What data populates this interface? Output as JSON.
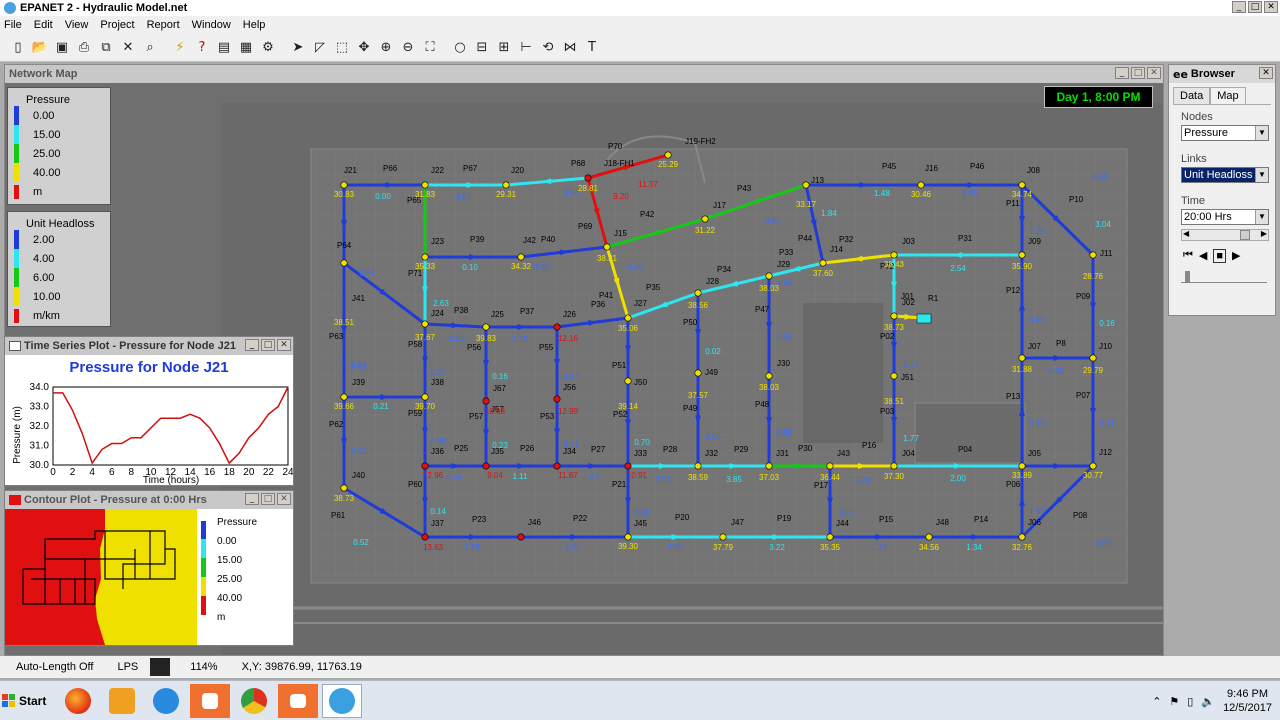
{
  "app": {
    "title": "EPANET 2 - Hydraulic Model.net"
  },
  "menu": [
    "File",
    "Edit",
    "View",
    "Project",
    "Report",
    "Window",
    "Help"
  ],
  "network_map": {
    "title": "Network Map",
    "clock": "Day 1, 8:00 PM",
    "pressure_legend": {
      "title": "Pressure",
      "values": [
        "0.00",
        "15.00",
        "25.00",
        "40.00",
        "m"
      ]
    },
    "headloss_legend": {
      "title": "Unit Headloss",
      "values": [
        "2.00",
        "4.00",
        "6.00",
        "10.00",
        "m/km"
      ]
    },
    "node_labels": [
      "J21",
      "J22",
      "J20",
      "J18-FH1",
      "J19-FH2",
      "J13",
      "J16",
      "J08",
      "J17",
      "J23",
      "J42",
      "J15",
      "J03",
      "J09",
      "J11",
      "J41",
      "J24",
      "J25",
      "J26",
      "J27",
      "J28",
      "J29",
      "J14",
      "J02",
      "R1",
      "J07",
      "J10",
      "J39",
      "J38",
      "J36",
      "J35",
      "J34",
      "J33",
      "J32",
      "J31",
      "J43",
      "J04",
      "J05",
      "J12",
      "J40",
      "J37",
      "J46",
      "J45",
      "J47",
      "J44",
      "J48",
      "J06",
      "J30",
      "J01",
      "J50",
      "J49",
      "J51",
      "J56",
      "J57",
      "J67"
    ],
    "link_labels": [
      "P66",
      "P67",
      "P68",
      "P70",
      "P45",
      "P46",
      "P65",
      "P43",
      "P42",
      "P69",
      "P39",
      "P40",
      "P44",
      "P32",
      "P31",
      "P11",
      "P10",
      "P64",
      "P71",
      "P34",
      "P33",
      "P35",
      "P41",
      "P36",
      "P72",
      "P12",
      "P09",
      "P38",
      "P37",
      "P50",
      "P47",
      "P63",
      "P58",
      "P55",
      "P51",
      "P02",
      "P8",
      "P07",
      "P56",
      "P57",
      "P53",
      "P52",
      "P49",
      "P48",
      "P03",
      "P13",
      "P62",
      "P59",
      "P25",
      "P26",
      "P27",
      "P28",
      "P29",
      "P30",
      "P16",
      "P04",
      "P17",
      "P60",
      "P21",
      "P06",
      "P61",
      "P23",
      "P22",
      "P20",
      "P19",
      "P15",
      "P14",
      "P08"
    ],
    "pressure_values": [
      "30.83",
      "31.83",
      "29.31",
      "28.81",
      "25.29",
      "33.17",
      "30.46",
      "34.74",
      "31.22",
      "35.33",
      "34.32",
      "38.31",
      "38.43",
      "35.90",
      "28.76",
      "38.51",
      "37.67",
      "39.83",
      "35.06",
      "38.56",
      "38.03",
      "37.60",
      "38.73",
      "31.88",
      "29.79",
      "39.66",
      "39.70",
      "39.14",
      "37.57",
      "38.03",
      "38.51",
      "33.89",
      "30.77",
      "38.73",
      "38.59",
      "37.03",
      "36.44",
      "37.30",
      "32.76",
      "39.30",
      "37.79",
      "35.35",
      "34.56"
    ],
    "low_pressure_values": [
      "9.20",
      "11.37",
      "12.16",
      "10.68",
      "12.99",
      "12.96",
      "9.04",
      "11.87",
      "10.91",
      "13.63"
    ],
    "flow_values": [
      "0.00",
      "3.84",
      "3.56",
      "1.48",
      "1.65",
      "0.00",
      "1.84",
      "3.97",
      "3.94",
      "2.54",
      "1.28",
      "0.84",
      "0.10",
      "0.06",
      "6.20",
      "2.63",
      "0.53",
      "1.15",
      "0.02",
      "0.00",
      "0.59",
      "0.16",
      "0.83",
      "0.27",
      "0.16",
      "0.14",
      "0.98",
      "0.23",
      "0.21",
      "0.52",
      "1.11",
      "1.87",
      "2.93",
      "3.85",
      "0.00",
      "7.78",
      "2.00",
      "0.15",
      "0.11",
      "0.14",
      "0.62",
      "2.99",
      "3.22",
      "0.75",
      "1.19",
      "1.34",
      "1.07",
      "0.06",
      "0.52",
      "1.28",
      "1.45",
      "0.70",
      "0.22",
      "0.42",
      "0.21",
      "0.43",
      "1.77",
      "1.77",
      "0.06",
      "0.00",
      "3.04"
    ]
  },
  "time_series": {
    "window_title": "Time Series Plot - Pressure for Node J21",
    "chart_data": {
      "type": "line",
      "title": "Pressure for Node J21",
      "xlabel": "Time (hours)",
      "ylabel": "Pressure (m)",
      "xlim": [
        0,
        24
      ],
      "ylim": [
        30.0,
        34.0
      ],
      "xticks": [
        "0",
        "2",
        "4",
        "6",
        "8",
        "10",
        "12",
        "14",
        "16",
        "18",
        "20",
        "22",
        "24"
      ],
      "yticks": [
        "30.0",
        "31.0",
        "32.0",
        "33.0",
        "34.0"
      ],
      "x": [
        0,
        1,
        2,
        3,
        4,
        5,
        6,
        7,
        8,
        9,
        10,
        11,
        12,
        13,
        14,
        15,
        16,
        17,
        18,
        19,
        20,
        21,
        22,
        23,
        24
      ],
      "values": [
        33.7,
        33.7,
        32.8,
        31.6,
        30.1,
        30.8,
        31.1,
        31.1,
        31.4,
        31.4,
        31.9,
        32.4,
        32.4,
        32.4,
        32.6,
        32.4,
        31.9,
        31.1,
        30.1,
        30.6,
        31.4,
        31.9,
        32.6,
        33.0,
        34.0
      ]
    }
  },
  "contour": {
    "window_title": "Contour Plot - Pressure at 0:00 Hrs",
    "legend_title": "Pressure",
    "legend_values": [
      "0.00",
      "15.00",
      "25.00",
      "40.00",
      "m"
    ]
  },
  "browser": {
    "title": "Browser",
    "tabs": [
      "Data",
      "Map"
    ],
    "nodes_label": "Nodes",
    "nodes_value": "Pressure",
    "links_label": "Links",
    "links_value": "Unit Headloss",
    "time_label": "Time",
    "time_value": "20:00 Hrs"
  },
  "status": {
    "auto_length": "Auto-Length Off",
    "units": "LPS",
    "zoom": "114%",
    "xy": "X,Y: 39876.99, 11763.19"
  },
  "taskbar": {
    "start": "Start",
    "time": "9:46 PM",
    "date": "12/5/2017"
  },
  "colors": {
    "blue": "#1f3bd8",
    "cyan": "#2ee6f0",
    "green": "#17c917",
    "yellow": "#f0e000",
    "red": "#e01010",
    "map_bg": "#6f6f6f"
  }
}
